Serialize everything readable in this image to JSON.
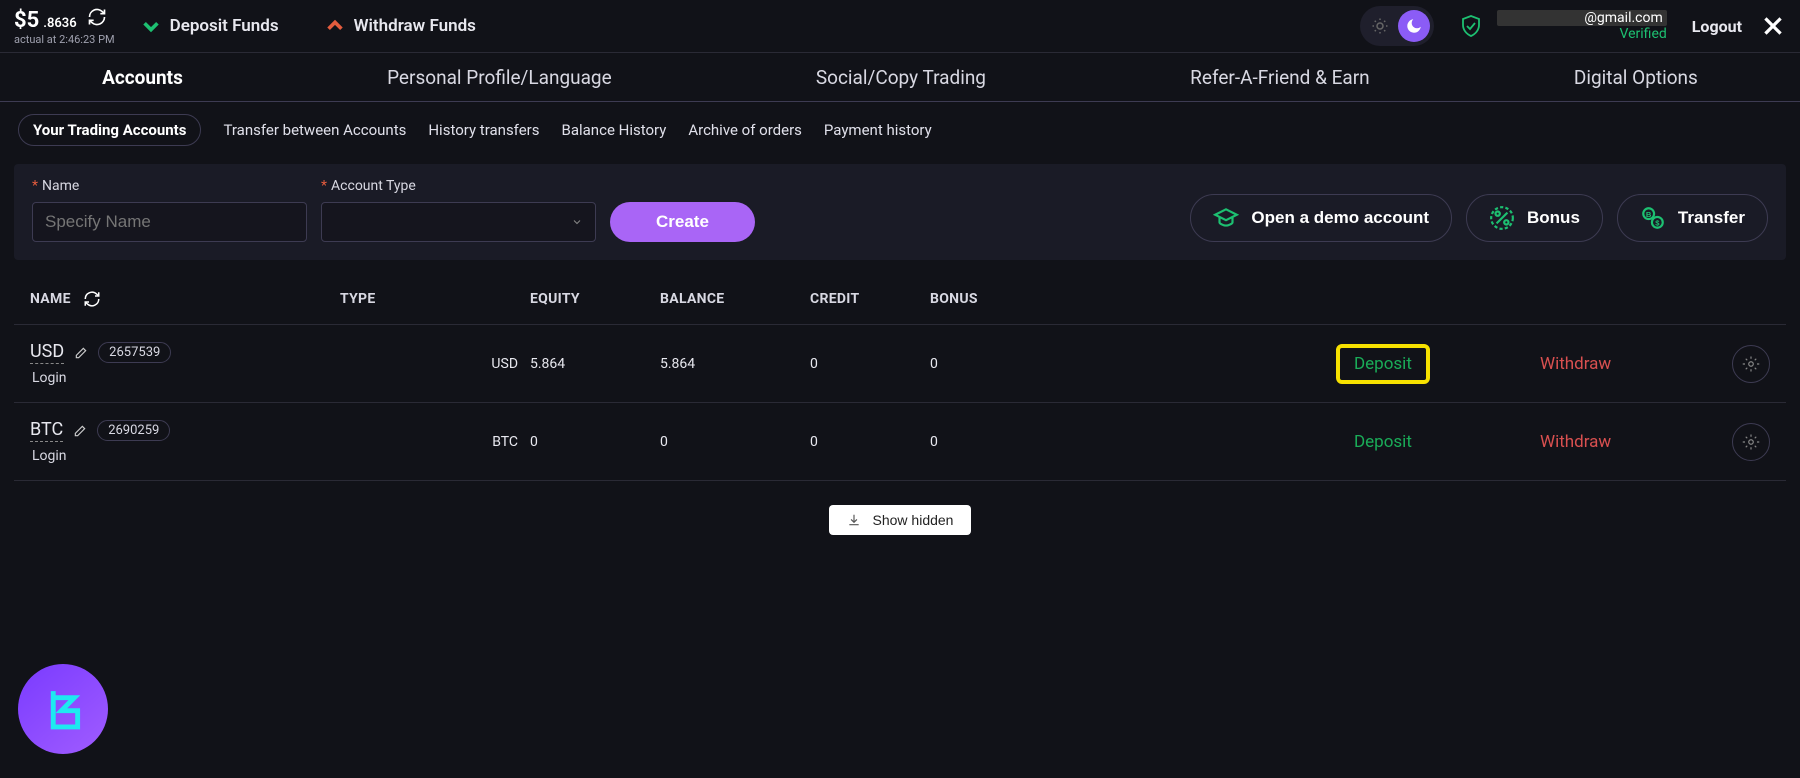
{
  "topbar": {
    "balance_main": "$5",
    "balance_dec": ".8636",
    "balance_sub": "actual at 2:46:23 PM",
    "deposit": "Deposit Funds",
    "withdraw": "Withdraw Funds",
    "email": "@gmail.com",
    "verified": "Verified",
    "logout": "Logout"
  },
  "mainnav": {
    "accounts": "Accounts",
    "profile": "Personal Profile/Language",
    "social": "Social/Copy Trading",
    "refer": "Refer-A-Friend & Earn",
    "digital": "Digital Options"
  },
  "subnav": {
    "trading": "Your Trading Accounts",
    "transfer": "Transfer between Accounts",
    "history_transfers": "History transfers",
    "balance_history": "Balance History",
    "archive": "Archive of orders",
    "payment": "Payment history"
  },
  "filter": {
    "name_label": "Name",
    "name_placeholder": "Specify Name",
    "type_label": "Account Type",
    "create": "Create",
    "demo": "Open a demo account",
    "bonus": "Bonus",
    "transfer": "Transfer"
  },
  "table": {
    "headers": {
      "name": "NAME",
      "type": "TYPE",
      "equity": "EQUITY",
      "balance": "BALANCE",
      "credit": "CREDIT",
      "bonus": "BONUS"
    },
    "login": "Login",
    "deposit": "Deposit",
    "withdraw": "Withdraw",
    "rows": [
      {
        "currency": "USD",
        "id": "2657539",
        "type": "USD",
        "equity": "5.864",
        "balance": "5.864",
        "credit": "0",
        "bonus": "0",
        "highlight": true
      },
      {
        "currency": "BTC",
        "id": "2690259",
        "type": "BTC",
        "equity": "0",
        "balance": "0",
        "credit": "0",
        "bonus": "0",
        "highlight": false
      }
    ]
  },
  "show_hidden": "Show hidden"
}
